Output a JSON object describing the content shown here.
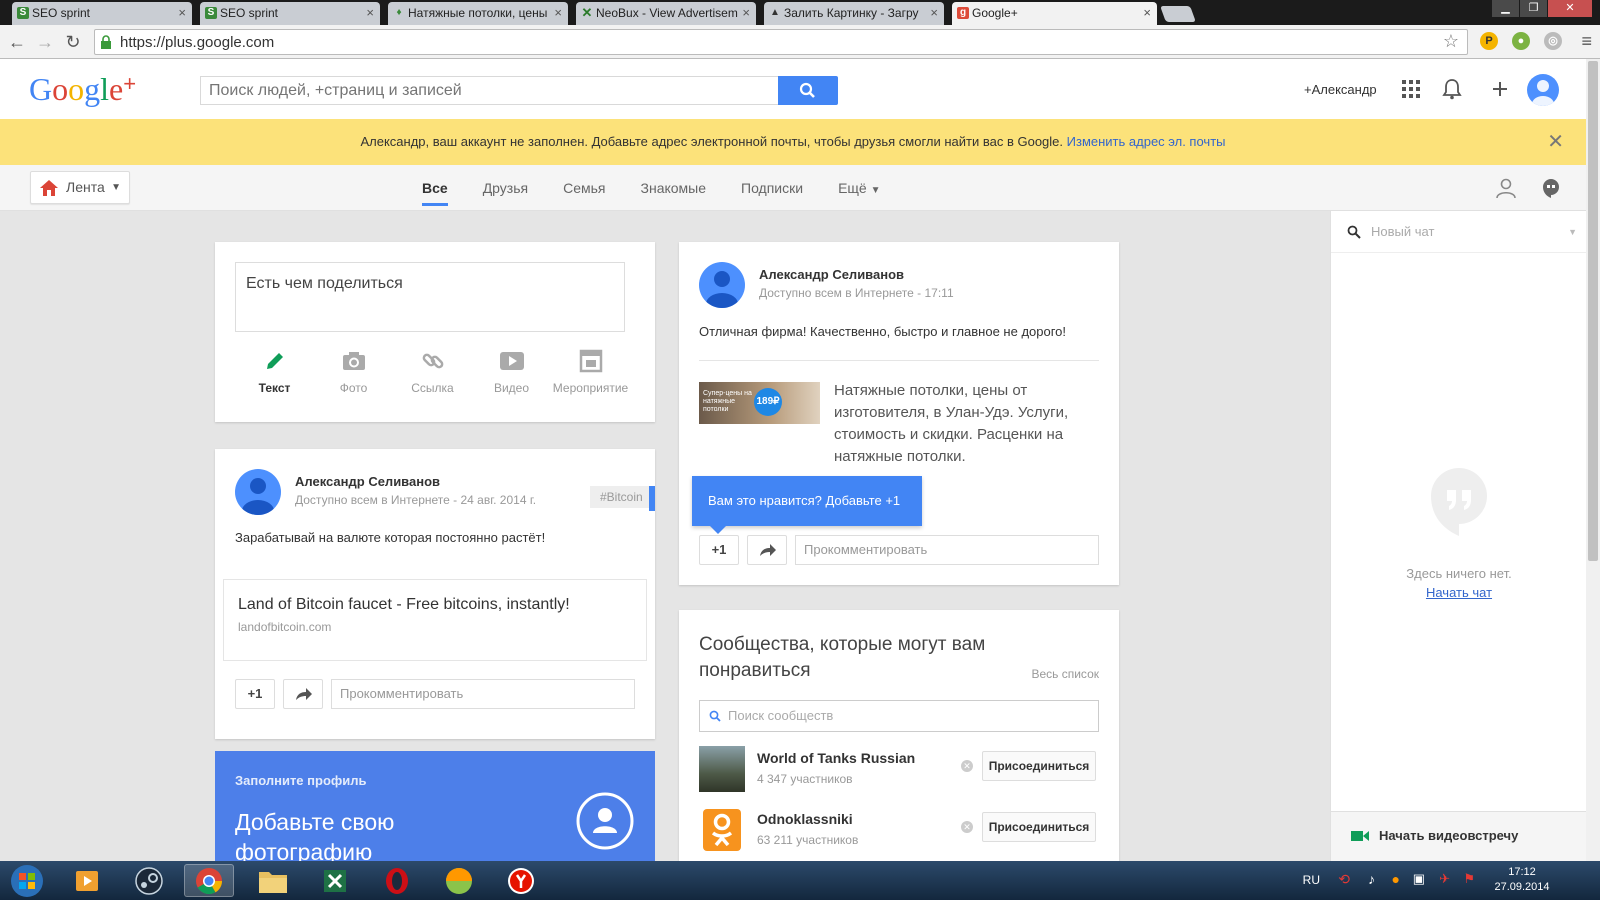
{
  "browser": {
    "tabs": [
      {
        "title": "SEO sprint",
        "active": false
      },
      {
        "title": "SEO sprint",
        "active": false
      },
      {
        "title": "Натяжные потолки, цены",
        "active": false
      },
      {
        "title": "NeoBux - View Advertisem",
        "active": false
      },
      {
        "title": "Залить Картинку - Загру",
        "active": false
      },
      {
        "title": "Google+",
        "active": true
      }
    ],
    "url": "https://plus.google.com"
  },
  "header": {
    "search_placeholder": "Поиск людей, +страниц и записей",
    "user_link": "+Александр"
  },
  "notice": {
    "text": "Александр, ваш аккаунт не заполнен. Добавьте адрес электронной почты, чтобы друзья смогли найти вас в Google.",
    "link": "Изменить адрес эл. почты"
  },
  "subnav": {
    "dropdown": "Лента",
    "tabs": [
      "Все",
      "Друзья",
      "Семья",
      "Знакомые",
      "Подписки",
      "Ещё"
    ],
    "active_tab": "Все"
  },
  "sharebox": {
    "placeholder": "Есть чем поделиться",
    "options": [
      {
        "label": "Текст",
        "icon": "pencil-icon",
        "active": true
      },
      {
        "label": "Фото",
        "icon": "camera-icon",
        "active": false
      },
      {
        "label": "Ссылка",
        "icon": "link-icon",
        "active": false
      },
      {
        "label": "Видео",
        "icon": "video-icon",
        "active": false
      },
      {
        "label": "Мероприятие",
        "icon": "event-icon",
        "active": false
      }
    ]
  },
  "post1": {
    "author": "Александр Селиванов",
    "visibility": "Доступно всем в Интернете",
    "date": "24 авг. 2014 г.",
    "hashtag": "#Bitcoin",
    "text": "Зарабатывай на валюте которая постоянно растёт!",
    "link_title": "Land of Bitcoin faucet - Free bitcoins, instantly!",
    "link_domain": "landofbitcoin.com",
    "plus_one": "+1",
    "comment_placeholder": "Прокомментировать"
  },
  "post2": {
    "author": "Александр Селиванов",
    "visibility": "Доступно всем в Интернете",
    "date": "17:11",
    "text": "Отличная фирма! Качественно, быстро и главное не дорого!",
    "link_text": "Натяжные потолки, цены от изготовителя, в Улан-Удэ. Услуги, стоимость и скидки. Расценки на натяжные потолки.",
    "thumb_text": "Супер-цены на натяжные потолки",
    "thumb_price": "189₽",
    "tooltip": "Вам это нравится? Добавьте +1",
    "plus_one": "+1",
    "comment_placeholder": "Прокомментировать"
  },
  "promo": {
    "subtitle": "Заполните профиль",
    "title": "Добавьте свою фотографию"
  },
  "communities": {
    "title": "Сообщества, которые могут вам понравиться",
    "see_all": "Весь список",
    "search_placeholder": "Поиск сообществ",
    "items": [
      {
        "name": "World of Tanks Russian",
        "members": "4 347 участников",
        "action": "Присоединиться"
      },
      {
        "name": "Odnoklassniki",
        "members": "63 211 участников",
        "action": "Присоединиться"
      }
    ]
  },
  "chat": {
    "search_placeholder": "Новый чат",
    "empty_text": "Здесь ничего нет.",
    "start_link": "Начать чат",
    "video_button": "Начать видеовстречу"
  },
  "taskbar": {
    "lang": "RU",
    "time": "17:12",
    "date": "27.09.2014"
  },
  "colors": {
    "accent": "#4285f4",
    "notice_bg": "#fce27a",
    "promo_bg": "#4d7fe9"
  }
}
